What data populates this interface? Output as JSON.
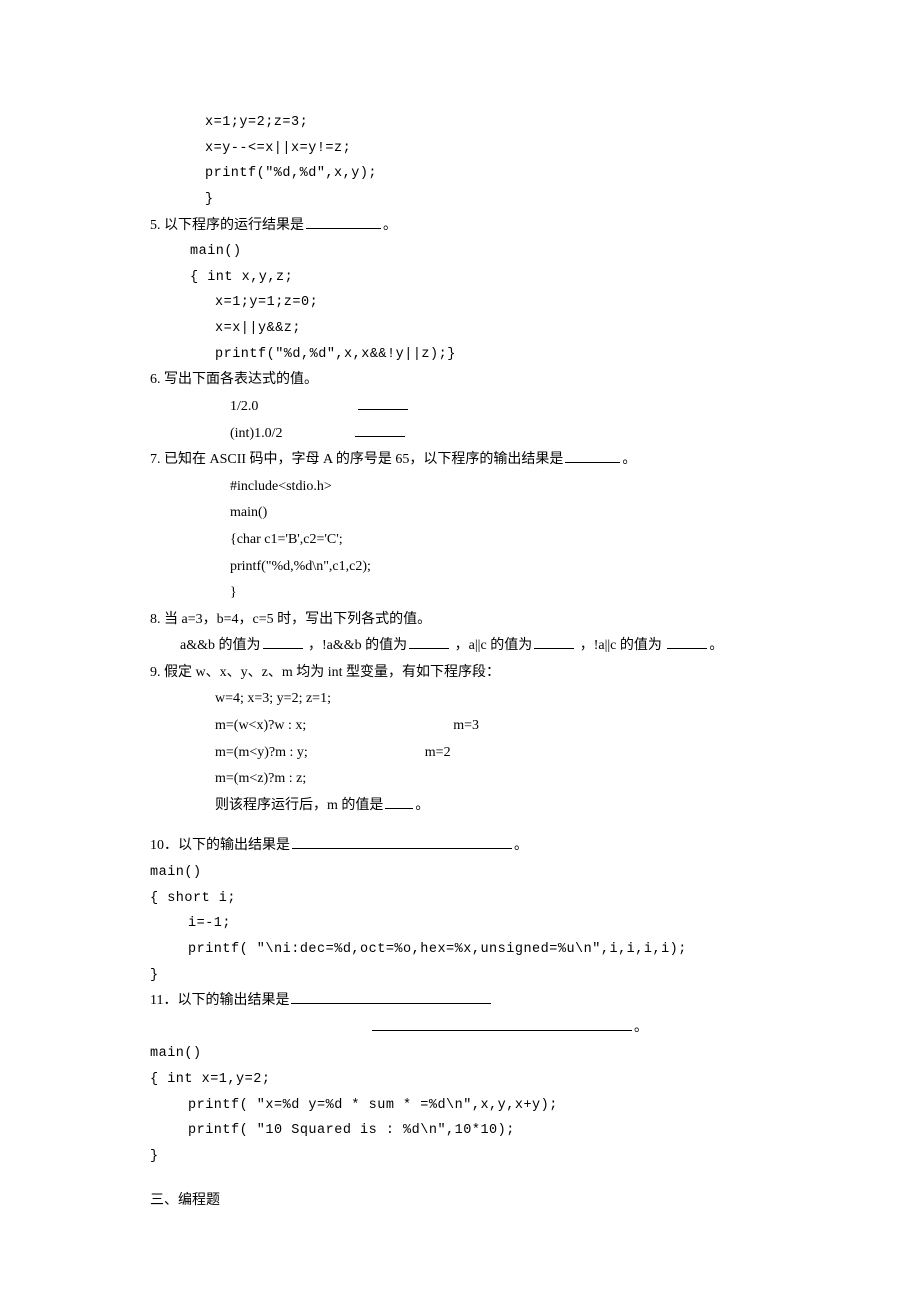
{
  "q4": {
    "code1": "x=1;y=2;z=3;",
    "code2": "x=y--<=x||x=y!=z;",
    "code3": "printf(\"%d,%d\",x,y);",
    "code4": "}"
  },
  "q5": {
    "text": "以下程序的运行结果是",
    "period": "。",
    "num": "5.",
    "code1": "main()",
    "code2": "{   int x,y,z;",
    "code3": "x=1;y=1;z=0;",
    "code4": "x=x||y&&z;",
    "code5": "printf(\"%d,%d\",x,x&&!y||z);}"
  },
  "q6": {
    "num": "6.",
    "text": "写出下面各表达式的值。",
    "expr1": "1/2.0",
    "expr2": "(int)1.0/2"
  },
  "q7": {
    "num": "7.",
    "text1": "已知在 ASCII 码中，字母 A 的序号是 65，以下程序的输出结果是",
    "period": "。",
    "code1": "#include<stdio.h>",
    "code2": "main()",
    "code3": "{char c1='B',c2='C';",
    "code4": "  printf(\"%d,%d\\n\",c1,c2);",
    "code5": "}"
  },
  "q8": {
    "num": "8.",
    "text": "当 a=3，b=4，c=5 时，写出下列各式的值。",
    "p1": "a&&b 的值为",
    "p2": "，!a&&b 的值为",
    "p3": "，a||c 的值为",
    "p4": "，!a||c 的值为",
    "period": "。"
  },
  "q9": {
    "num": "9.",
    "text": "假定 w、x、y、z、m 均为 int 型变量，有如下程序段：",
    "code1": "w=4; x=3; y=2; z=1;",
    "code2": "m=(w<x)?w : x;",
    "ans2": "m=3",
    "code3": "m=(m<y)?m : y;",
    "ans3": "m=2",
    "code4": "m=(m<z)?m : z;",
    "tail": "则该程序运行后，m 的值是",
    "period": "。"
  },
  "q10": {
    "num": "10．",
    "text": "以下的输出结果是",
    "period": "。",
    "code1": "main()",
    "code2": "{    short i;",
    "code3": "i=-1;",
    "code4": "printf( \"\\ni:dec=%d,oct=%o,hex=%x,unsigned=%u\\n\",i,i,i,i);",
    "code5": "}"
  },
  "q11": {
    "num": "11．",
    "text": "以下的输出结果是",
    "period": "。",
    "code1": "main()",
    "code2": "{    int x=1,y=2;",
    "code3": "printf( \"x=%d y=%d * sum * =%d\\n\",x,y,x+y);",
    "code4": "printf( \"10 Squared is : %d\\n\",10*10);",
    "code5": "}"
  },
  "s3": {
    "title": "三、编程题"
  }
}
